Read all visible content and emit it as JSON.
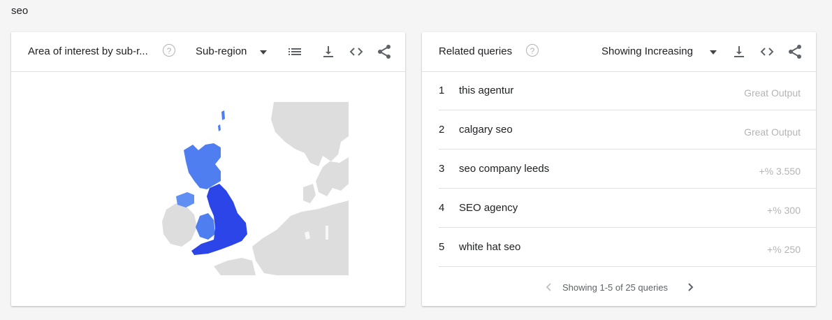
{
  "search_term": "seo",
  "left_card": {
    "title": "Area of interest by sub-r...",
    "help": "?",
    "dropdown_label": "Sub-region",
    "icons": [
      "list-icon",
      "download-icon",
      "embed-icon",
      "share-icon"
    ],
    "map_colors": {
      "land": "#dddddd",
      "high": "#2b45e8",
      "medium": "#4f7ef0",
      "low": "#5f8ff2"
    }
  },
  "right_card": {
    "title": "Related queries",
    "help": "?",
    "dropdown_label": "Showing Increasing",
    "icons": [
      "download-icon",
      "embed-icon",
      "share-icon"
    ],
    "rows": [
      {
        "rank": "1",
        "query": "this agentur",
        "value": "Great Output"
      },
      {
        "rank": "2",
        "query": "calgary seo",
        "value": "Great Output"
      },
      {
        "rank": "3",
        "query": "seo company leeds",
        "value": "+% 3.550"
      },
      {
        "rank": "4",
        "query": "SEO agency",
        "value": "+% 300"
      },
      {
        "rank": "5",
        "query": "white hat seo",
        "value": "+% 250"
      }
    ],
    "pager_text": "Showing 1-5 of 25 queries"
  }
}
